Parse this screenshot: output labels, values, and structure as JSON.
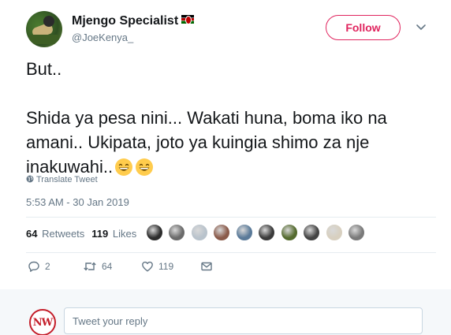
{
  "author": {
    "name": "Mjengo Specialist",
    "handle": "@JoeKenya_",
    "follow_label": "Follow"
  },
  "tweet": {
    "line1": "But..",
    "line2": "Shida ya pesa nini... Wakati huna, boma iko na amani.. Ukipata, joto ya kuingia shimo za nje inakuwahi..",
    "translate_label": "Translate Tweet",
    "timestamp": "5:53 AM - 30 Jan 2019"
  },
  "stats": {
    "retweets_count": "64",
    "retweets_label": "Retweets",
    "likes_count": "119",
    "likes_label": "Likes"
  },
  "likers": [
    "#2d2d2d",
    "#6b6b6b",
    "#b9c3cc",
    "#8a5a4a",
    "#5a7a99",
    "#3b3b3b",
    "#556b2f",
    "#444444",
    "#d8d0c0",
    "#7a7a7a"
  ],
  "actions": {
    "reply_count": "2",
    "retweet_count": "64",
    "like_count": "119"
  },
  "reply": {
    "placeholder": "Tweet your reply",
    "logo_text": "NW"
  },
  "colors": {
    "accent": "#e0245e",
    "muted": "#657786",
    "brand_logo": "#c41e2a"
  }
}
